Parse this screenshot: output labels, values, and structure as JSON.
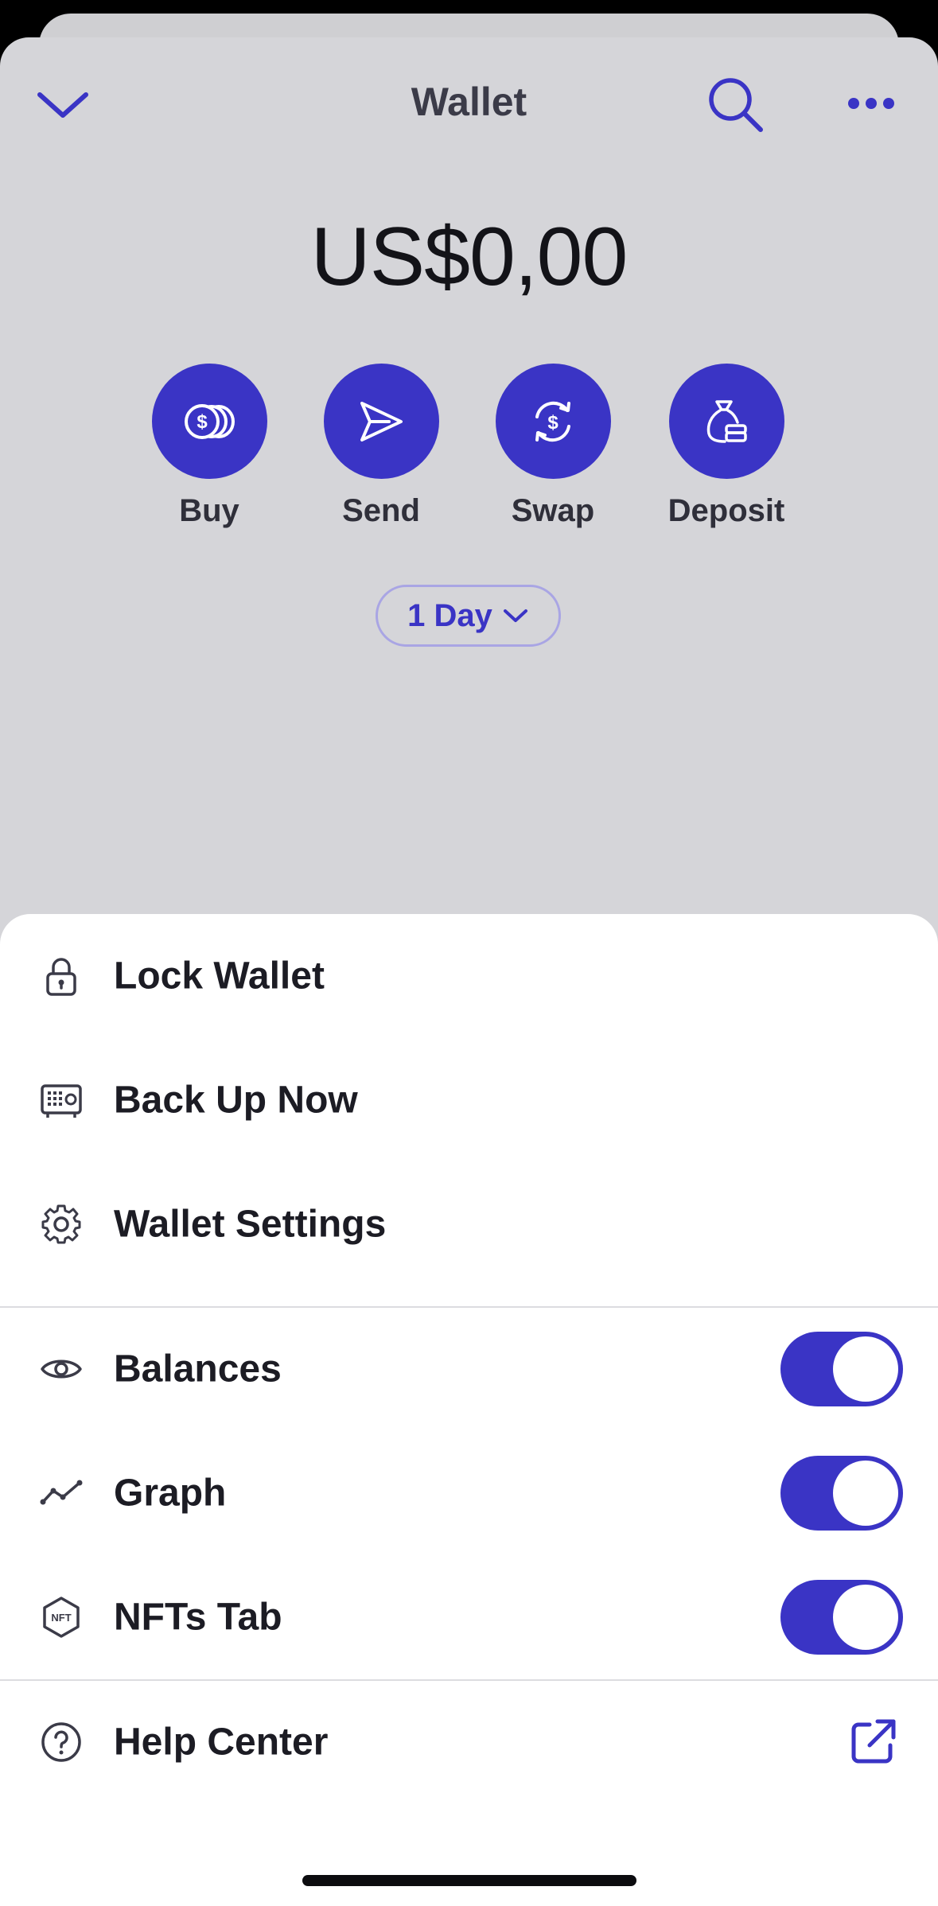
{
  "header": {
    "title": "Wallet"
  },
  "balance": {
    "amount": "US$0,00"
  },
  "actions": [
    {
      "label": "Buy"
    },
    {
      "label": "Send"
    },
    {
      "label": "Swap"
    },
    {
      "label": "Deposit"
    }
  ],
  "period": {
    "selected": "1 Day"
  },
  "menu": {
    "lock": "Lock Wallet",
    "backup": "Back Up Now",
    "settings": "Wallet Settings",
    "balances": {
      "label": "Balances",
      "enabled": true
    },
    "graph": {
      "label": "Graph",
      "enabled": true
    },
    "nfts": {
      "label": "NFTs Tab",
      "enabled": true
    },
    "help": "Help Center"
  },
  "colors": {
    "accent": "#3a34c5",
    "background": "#d5d5d9",
    "sheet": "#ffffff"
  }
}
